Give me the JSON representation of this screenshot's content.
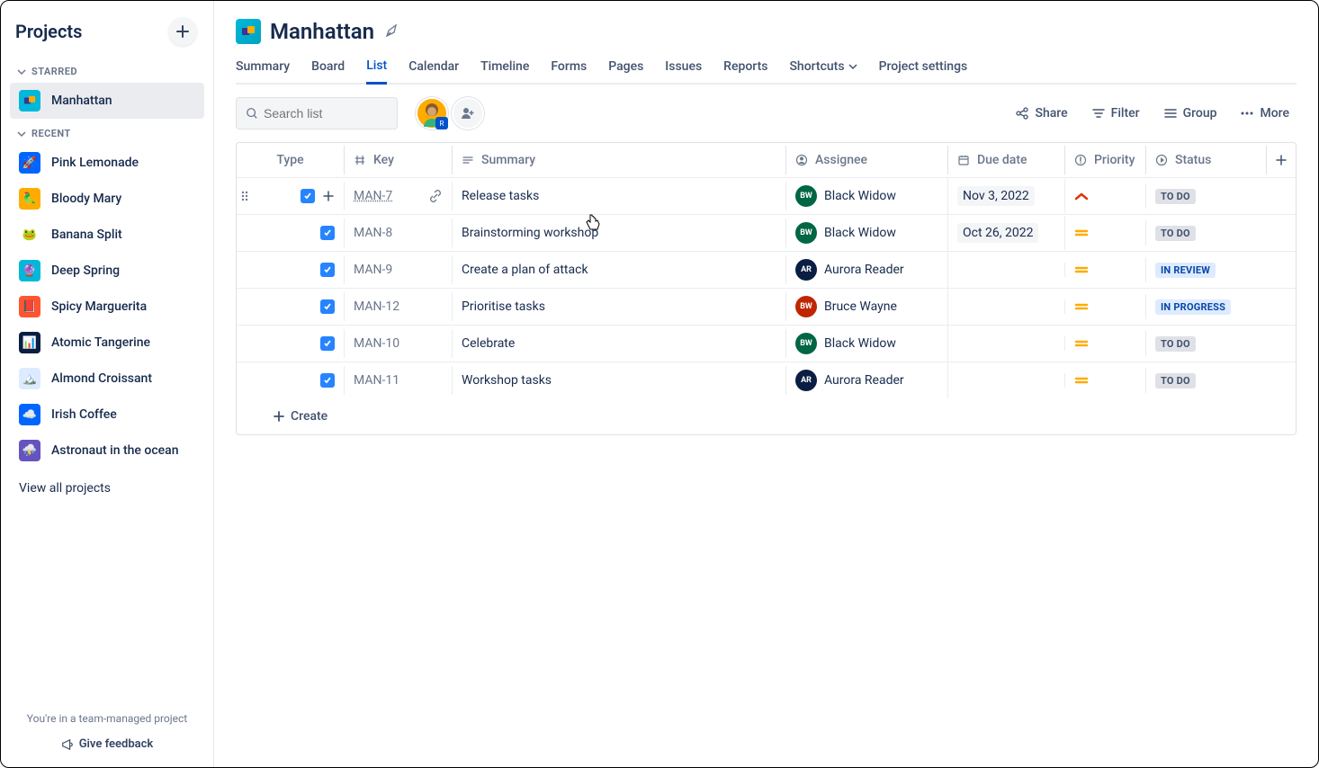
{
  "sidebar": {
    "title": "Projects",
    "sections": {
      "starred": {
        "label": "STARRED",
        "items": [
          {
            "name": "Manhattan",
            "bg": "#00B8D9"
          }
        ]
      },
      "recent": {
        "label": "RECENT",
        "items": [
          {
            "name": "Pink Lemonade",
            "bg": "#0065FF",
            "emoji": "🚀"
          },
          {
            "name": "Bloody Mary",
            "bg": "#FFAB00",
            "emoji": "🦜"
          },
          {
            "name": "Banana Split",
            "bg": "#FFFFFF",
            "emoji": "🐸"
          },
          {
            "name": "Deep Spring",
            "bg": "#00B8D9",
            "emoji": "🔮"
          },
          {
            "name": "Spicy Marguerita",
            "bg": "#FF5630",
            "emoji": "📕"
          },
          {
            "name": "Atomic Tangerine",
            "bg": "#091E42",
            "emoji": "📊"
          },
          {
            "name": "Almond Croissant",
            "bg": "#DEEBFF",
            "emoji": "🏔️"
          },
          {
            "name": "Irish Coffee",
            "bg": "#0065FF",
            "emoji": "☁️"
          },
          {
            "name": "Astronaut in the ocean",
            "bg": "#6554C0",
            "emoji": "⛈️"
          }
        ]
      }
    },
    "view_all": "View all projects",
    "footer_note": "You're in a team-managed project",
    "feedback": "Give feedback"
  },
  "project": {
    "title": "Manhattan"
  },
  "tabs": [
    {
      "label": "Summary"
    },
    {
      "label": "Board"
    },
    {
      "label": "List"
    },
    {
      "label": "Calendar"
    },
    {
      "label": "Timeline"
    },
    {
      "label": "Forms"
    },
    {
      "label": "Pages"
    },
    {
      "label": "Issues"
    },
    {
      "label": "Reports"
    },
    {
      "label": "Shortcuts",
      "dropdown": true
    },
    {
      "label": "Project settings"
    }
  ],
  "active_tab": 2,
  "toolbar": {
    "search_placeholder": "Search list",
    "share": "Share",
    "filter": "Filter",
    "group": "Group",
    "more": "More"
  },
  "columns": {
    "type": "Type",
    "key": "Key",
    "summary": "Summary",
    "assignee": "Assignee",
    "due": "Due date",
    "priority": "Priority",
    "status": "Status"
  },
  "rows": [
    {
      "key": "MAN-7",
      "summary": "Release tasks",
      "assignee": {
        "name": "Black Widow",
        "initials": "BW",
        "color": "#006644"
      },
      "due": "Nov 3, 2022",
      "priority": "high",
      "status": "TO DO",
      "status_class": "st-todo",
      "hovered": true
    },
    {
      "key": "MAN-8",
      "summary": "Brainstorming workshop",
      "assignee": {
        "name": "Black Widow",
        "initials": "BW",
        "color": "#006644"
      },
      "due": "Oct 26, 2022",
      "priority": "medium",
      "status": "TO DO",
      "status_class": "st-todo"
    },
    {
      "key": "MAN-9",
      "summary": "Create a plan of attack",
      "assignee": {
        "name": "Aurora Reader",
        "initials": "AR",
        "color": "#091E42"
      },
      "due": "",
      "priority": "medium",
      "status": "IN REVIEW",
      "status_class": "st-review"
    },
    {
      "key": "MAN-12",
      "summary": "Prioritise tasks",
      "assignee": {
        "name": "Bruce Wayne",
        "initials": "BW",
        "color": "#BF2600"
      },
      "due": "",
      "priority": "medium",
      "status": "IN PROGRESS",
      "status_class": "st-progress"
    },
    {
      "key": "MAN-10",
      "summary": "Celebrate",
      "assignee": {
        "name": "Black Widow",
        "initials": "BW",
        "color": "#006644"
      },
      "due": "",
      "priority": "medium",
      "status": "TO DO",
      "status_class": "st-todo"
    },
    {
      "key": "MAN-11",
      "summary": "Workshop tasks",
      "assignee": {
        "name": "Aurora Reader",
        "initials": "AR",
        "color": "#091E42"
      },
      "due": "",
      "priority": "medium",
      "status": "TO DO",
      "status_class": "st-todo"
    }
  ],
  "create_label": "Create"
}
